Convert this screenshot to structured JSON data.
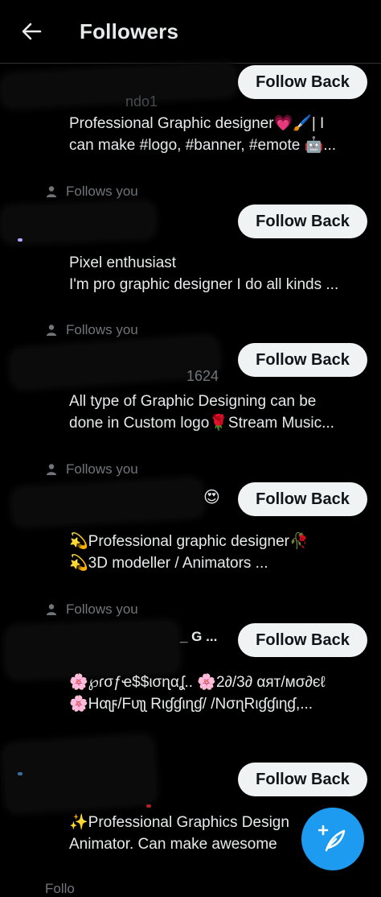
{
  "header": {
    "title": "Followers",
    "back_icon": "arrow-left-icon"
  },
  "colors": {
    "background": "#000000",
    "accent": "#1d9bf0",
    "secondary_text": "#71767b",
    "button_bg": "#eff3f4"
  },
  "followers": [
    {
      "follows_you": "",
      "handle_fragment": "ndo1",
      "name_fragment": "",
      "button": "Follow Back",
      "bio": [
        "Professional Graphic designer💗🖌️| I",
        "can make #logo, #banner, #emote 🤖..."
      ]
    },
    {
      "follows_you": "Follows you",
      "handle_fragment": "",
      "name_fragment": "",
      "button": "Follow Back",
      "bio": [
        "Pixel enthusiast",
        "I'm pro graphic designer I do all kinds ..."
      ]
    },
    {
      "follows_you": "Follows you",
      "handle_fragment": "1624",
      "name_fragment": "",
      "button": "Follow Back",
      "bio": [
        "All type of Graphic Designing can be",
        "done in Custom logo🌹Stream Music..."
      ]
    },
    {
      "follows_you": "Follows you",
      "handle_fragment": "",
      "name_fragment": "😍",
      "button": "Follow Back",
      "bio": [
        "💫Professional graphic designer🥀",
        "💫3D modeller / Animators ..."
      ]
    },
    {
      "follows_you": "Follows you",
      "handle_fragment": "",
      "name_fragment": "_ G ...",
      "button": "Follow Back",
      "bio": [
        "🌸℘ɾσƒҽ$$ισɳαʆ.. 🌸2∂/3∂ αят/мσ∂єℓ",
        "🌸Hαʅϝ/Fυʅʅ Rιɠɠιɳɠ/ /NσɳRιɠɠιɳɠ,..."
      ]
    },
    {
      "follows_you": "",
      "handle_fragment": "",
      "name_fragment": "",
      "button": "Follow Back",
      "bio": [
        "✨Professional Graphics Design",
        "Animator. Can make awesome"
      ]
    }
  ],
  "next_follows_you": "Follo",
  "fab": {
    "icon": "compose-plus-icon"
  }
}
